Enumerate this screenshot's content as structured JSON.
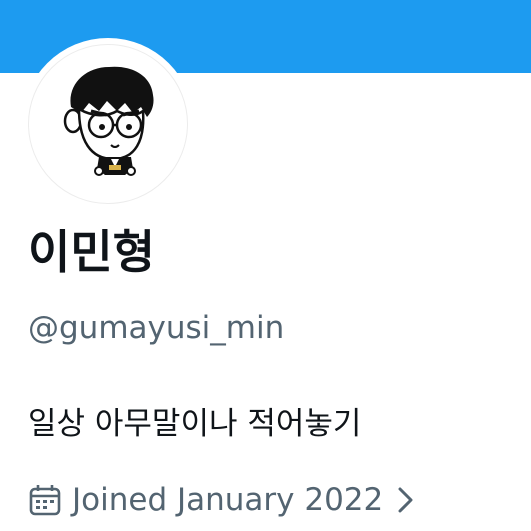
{
  "colors": {
    "banner": "#1d9bf0",
    "primary_text": "#0f1419",
    "secondary_text": "#536471"
  },
  "profile": {
    "avatar_icon": "cartoon-avatar-icon",
    "display_name": "이민형",
    "handle": "@gumayusi_min",
    "bio": "일상 아무말이나 적어놓기",
    "joined": {
      "icon": "calendar-icon",
      "label": "Joined January 2022",
      "trailing_icon": "chevron-right-icon"
    }
  }
}
